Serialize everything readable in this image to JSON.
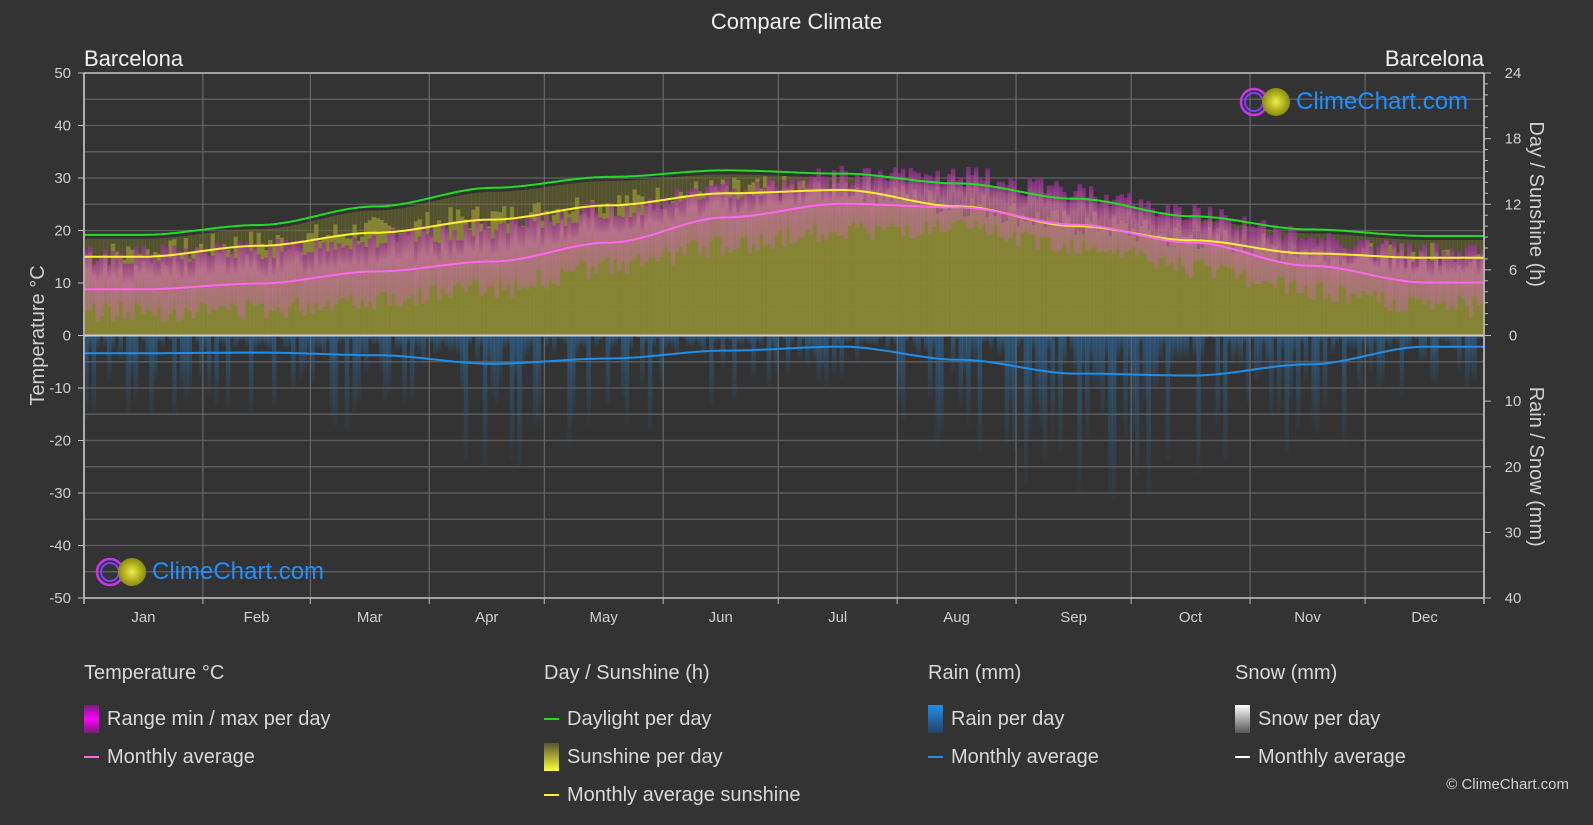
{
  "title": "Compare Climate",
  "city_left": "Barcelona",
  "city_right": "Barcelona",
  "logo_text": "ClimeChart.com",
  "copyright": "© ClimeChart.com",
  "colors": {
    "background": "#333333",
    "grid": "#5a5a5a",
    "temp_range": "#ff00ff",
    "temp_avg": "#ff66ee",
    "daylight": "#22dd22",
    "sunshine_fill": "#8a8a35",
    "sunshine_avg": "#ffee33",
    "rain": "#1e8ee8",
    "snow": "#ffffff",
    "logo_text": "#1e90ff"
  },
  "legend": {
    "temperature": {
      "title": "Temperature °C",
      "items": [
        "Range min / max per day",
        "Monthly average"
      ]
    },
    "sunshine": {
      "title": "Day / Sunshine (h)",
      "items": [
        "Daylight per day",
        "Sunshine per day",
        "Monthly average sunshine"
      ]
    },
    "rain": {
      "title": "Rain (mm)",
      "items": [
        "Rain per day",
        "Monthly average"
      ]
    },
    "snow": {
      "title": "Snow (mm)",
      "items": [
        "Snow per day",
        "Monthly average"
      ]
    }
  },
  "chart_data": {
    "type": "line",
    "title": "Compare Climate",
    "categories": [
      "Jan",
      "Feb",
      "Mar",
      "Apr",
      "May",
      "Jun",
      "Jul",
      "Aug",
      "Sep",
      "Oct",
      "Nov",
      "Dec"
    ],
    "axes": {
      "left": {
        "label": "Temperature °C",
        "range": [
          -50,
          50
        ],
        "ticks": [
          50,
          40,
          30,
          20,
          10,
          0,
          -10,
          -20,
          -30,
          -40,
          -50
        ]
      },
      "right_top": {
        "label": "Day / Sunshine (h)",
        "range": [
          0,
          24
        ],
        "ticks": [
          24,
          18,
          12,
          6,
          0
        ]
      },
      "right_bottom": {
        "label": "Rain / Snow (mm)",
        "range": [
          0,
          40
        ],
        "ticks": [
          0,
          10,
          20,
          30,
          40
        ]
      }
    },
    "grid": true,
    "series": [
      {
        "name": "Temperature monthly average",
        "axis": "left",
        "unit": "°C",
        "values": [
          8.8,
          9.9,
          12.2,
          14.1,
          17.7,
          22.5,
          25.1,
          24.4,
          21.1,
          17.7,
          13.3,
          10.1
        ]
      },
      {
        "name": "Temperature daily max (approx.)",
        "axis": "left",
        "unit": "°C",
        "values": [
          14.5,
          15.5,
          17.5,
          19.5,
          23,
          27,
          29.5,
          29.5,
          26.5,
          22.5,
          18,
          15
        ]
      },
      {
        "name": "Temperature daily min (approx.)",
        "axis": "left",
        "unit": "°C",
        "values": [
          4.5,
          5,
          7,
          9,
          13,
          17,
          20,
          20,
          17,
          13,
          8.5,
          5.5
        ]
      },
      {
        "name": "Daylight per day",
        "axis": "right_top",
        "unit": "h",
        "values": [
          9.2,
          10.1,
          11.8,
          13.5,
          14.5,
          15.1,
          14.8,
          13.9,
          12.5,
          10.9,
          9.7,
          9.1
        ]
      },
      {
        "name": "Monthly average sunshine",
        "axis": "right_top",
        "unit": "h",
        "values": [
          7.2,
          8.2,
          9.4,
          10.6,
          11.9,
          13.0,
          13.3,
          11.8,
          10.0,
          8.7,
          7.5,
          7.1
        ]
      },
      {
        "name": "Rain monthly average",
        "axis": "right_bottom",
        "unit": "mm",
        "values": [
          2.7,
          2.6,
          3.0,
          4.3,
          3.5,
          2.3,
          1.7,
          3.7,
          5.8,
          6.1,
          4.4,
          1.7
        ]
      },
      {
        "name": "Snow monthly average",
        "axis": "right_bottom",
        "unit": "mm",
        "values": [
          0,
          0,
          0,
          0,
          0,
          0,
          0,
          0,
          0,
          0,
          0,
          0
        ]
      }
    ]
  }
}
